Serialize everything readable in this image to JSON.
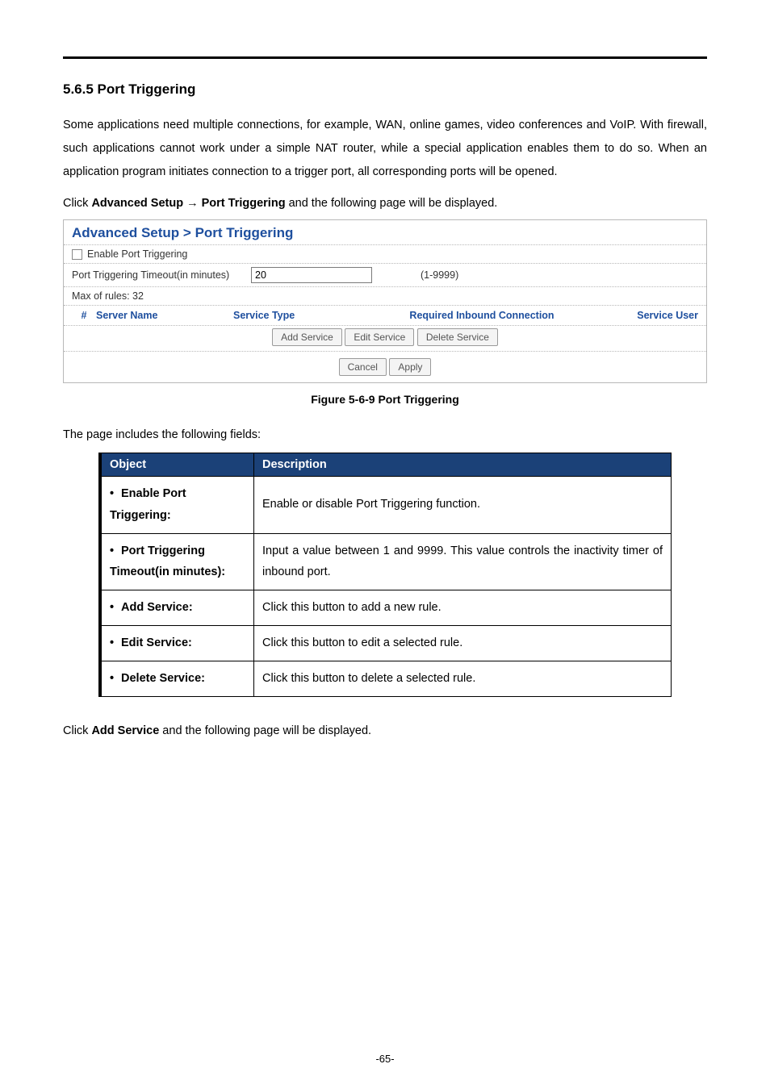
{
  "heading": "5.6.5  Port Triggering",
  "intro_para": "Some applications need multiple connections, for example, WAN, online games, video conferences and VoIP. With firewall, such applications cannot work under a simple NAT router, while a special application enables them to do so. When an application program initiates connection to a trigger port, all corresponding ports will be opened.",
  "nav_prefix": "Click ",
  "nav_b1": "Advanced Setup",
  "nav_arrow": " → ",
  "nav_b2": "Port Triggering",
  "nav_suffix": " and the following page will be displayed.",
  "panel": {
    "title": "Advanced Setup > Port Triggering",
    "enable_label": "Enable Port Triggering",
    "timeout_label": "Port Triggering Timeout(in minutes)",
    "timeout_value": "20",
    "timeout_hint": "(1-9999)",
    "max_rules": "Max of rules: 32",
    "cols": {
      "c1": "#",
      "c2": "Server Name",
      "c3": "Service Type",
      "c4": "Required Inbound Connection",
      "c5": "Service User"
    },
    "buttons": {
      "add": "Add Service",
      "edit": "Edit Service",
      "del": "Delete Service",
      "cancel": "Cancel",
      "apply": "Apply"
    }
  },
  "figure_caption": "Figure 5-6-9 Port Triggering",
  "fields_intro": "The page includes the following fields:",
  "table": {
    "head_obj": "Object",
    "head_desc": "Description",
    "rows": [
      {
        "obj": "Enable Port Triggering:",
        "desc": "Enable or disable Port Triggering function."
      },
      {
        "obj": "Port Triggering Timeout(in minutes):",
        "desc": "Input a value between 1 and 9999. This value controls the inactivity timer of inbound port."
      },
      {
        "obj": "Add Service:",
        "desc": "Click this button to add a new rule."
      },
      {
        "obj": "Edit Service:",
        "desc": "Click this button to edit a selected rule."
      },
      {
        "obj": "Delete Service:",
        "desc": "Click this button to delete a selected rule."
      }
    ]
  },
  "post_prefix": "Click ",
  "post_b": "Add Service",
  "post_suffix": " and the following page will be displayed.",
  "page_number": "-65-"
}
